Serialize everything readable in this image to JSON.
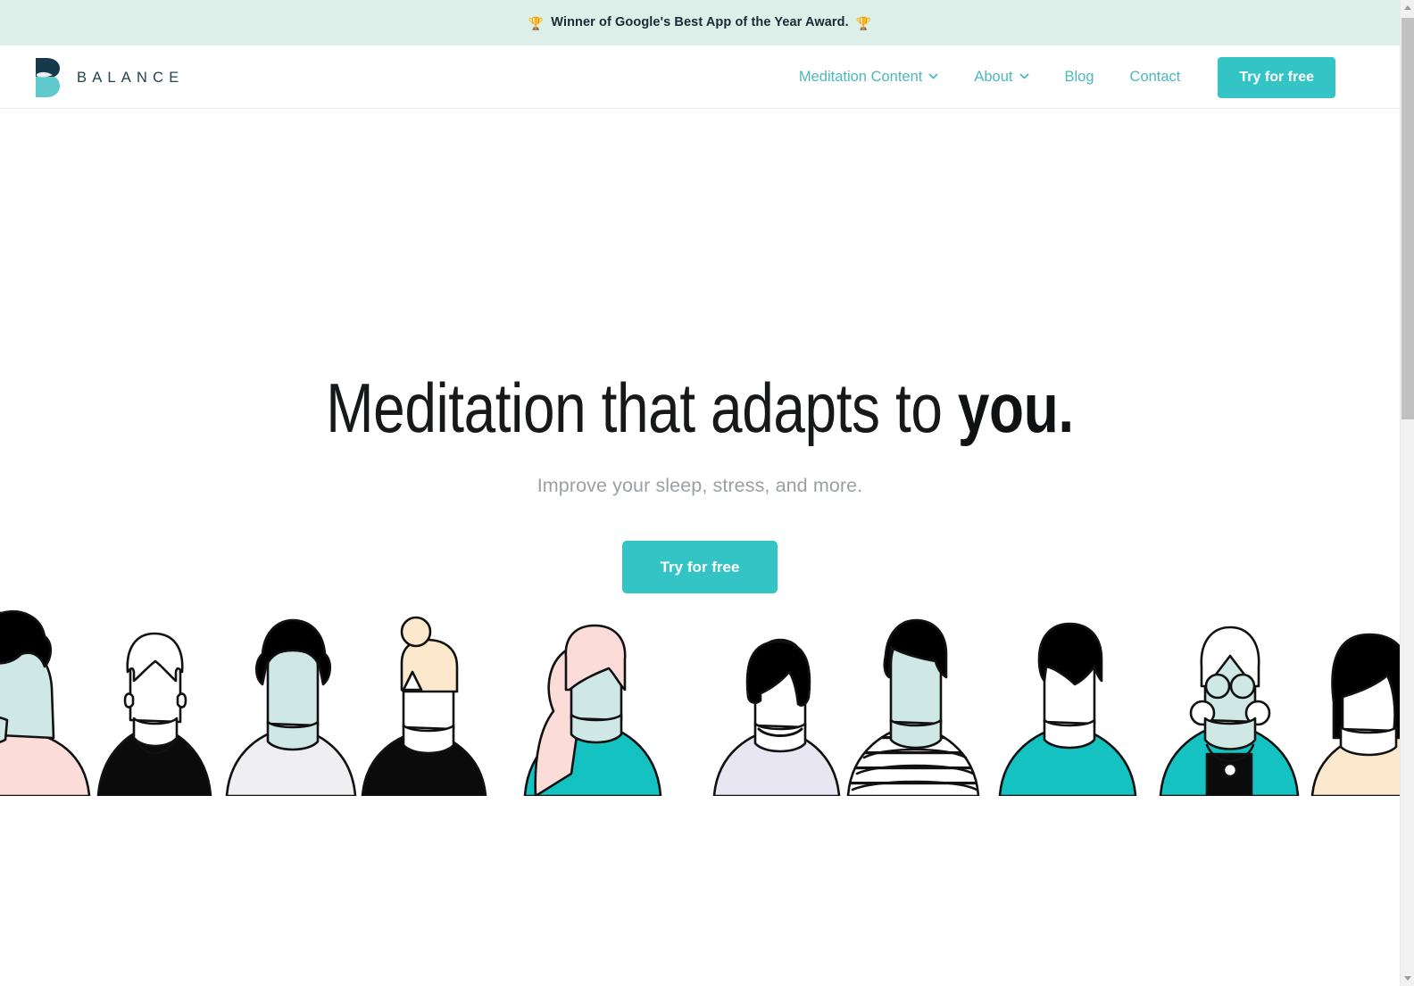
{
  "banner": {
    "icon_left": "trophy-icon",
    "icon_right": "trophy-icon",
    "text": "Winner of Google's Best App of the Year Award.",
    "background_color": "#DCEFE8",
    "text_color": "#1B2A33"
  },
  "header": {
    "logo": {
      "mark_name": "balance-b-logo-icon",
      "wordmark": "BALANCE",
      "color_top": "#16394B",
      "color_bottom": "#5FC9CE",
      "wordmark_color": "#23424F"
    },
    "nav": [
      {
        "label": "Meditation Content",
        "has_dropdown": true,
        "icon": "chevron-down-icon"
      },
      {
        "label": "About",
        "has_dropdown": true,
        "icon": "chevron-down-icon"
      },
      {
        "label": "Blog",
        "has_dropdown": false
      },
      {
        "label": "Contact",
        "has_dropdown": false
      }
    ],
    "cta_label": "Try for free",
    "nav_color": "#4CB8BD",
    "cta_background": "#35C4C6",
    "cta_text_color": "#FFFFFF"
  },
  "hero": {
    "title_plain": "Meditation that adapts to ",
    "title_accent": "you.",
    "subtitle": "Improve your sleep, stress, and more.",
    "cta_label": "Try for free",
    "title_color": "#16181A",
    "subtitle_color": "#9AA0A3",
    "background": "#FFFFFF"
  },
  "illustration": {
    "name": "crowd-of-people-illustration",
    "description": "Row of flat line-art people portraits across the bottom of the hero",
    "palette": {
      "hair_black": "#000000",
      "hair_blonde": "#FCE8CC",
      "hair_pink": "#FBDCD9",
      "skin_mint": "#CFE8E6",
      "skin_white": "#FFFFFF",
      "shirt_teal": "#14C2C2",
      "shirt_lavender": "#E8E6F2",
      "shirt_pink": "#FBDCD9",
      "shirt_offwhite": "#EFEFF1",
      "shirt_black": "#0B0B0B",
      "outline": "#111111"
    },
    "people": [
      {
        "index": 1,
        "hair": "hair_black",
        "skin": "skin_mint",
        "shirt": "shirt_pink"
      },
      {
        "index": 2,
        "hair": "outline-only",
        "skin": "skin_white",
        "shirt": "shirt_black"
      },
      {
        "index": 3,
        "hair": "hair_black",
        "skin": "skin_mint",
        "shirt": "shirt_offwhite"
      },
      {
        "index": 4,
        "hair": "hair_blonde",
        "skin": "skin_white",
        "shirt": "shirt_black"
      },
      {
        "index": 5,
        "hair": "hair_pink",
        "skin": "skin_mint",
        "shirt": "shirt_teal"
      },
      {
        "index": 6,
        "hair": "hair_black",
        "skin": "skin_white",
        "shirt": "shirt_lavender"
      },
      {
        "index": 7,
        "hair": "hair_black",
        "skin": "skin_mint",
        "shirt": "striped"
      },
      {
        "index": 8,
        "hair": "hair_black",
        "skin": "skin_white",
        "shirt": "shirt_teal"
      },
      {
        "index": 9,
        "hair": "outline-only",
        "skin": "skin_mint",
        "shirt": "shirt_teal",
        "accessories": [
          "glasses",
          "earrings",
          "necklace"
        ]
      },
      {
        "index": 10,
        "hair": "hair_black",
        "skin": "skin_white",
        "shirt": "shirt_blonde"
      }
    ]
  },
  "scrollbar": {
    "name": "page-scrollbar",
    "up_arrow": "scroll-up-arrow-icon",
    "down_arrow": "scroll-down-arrow-icon",
    "track_color": "#F1F1F1",
    "thumb_color": "#C1C1C1"
  }
}
